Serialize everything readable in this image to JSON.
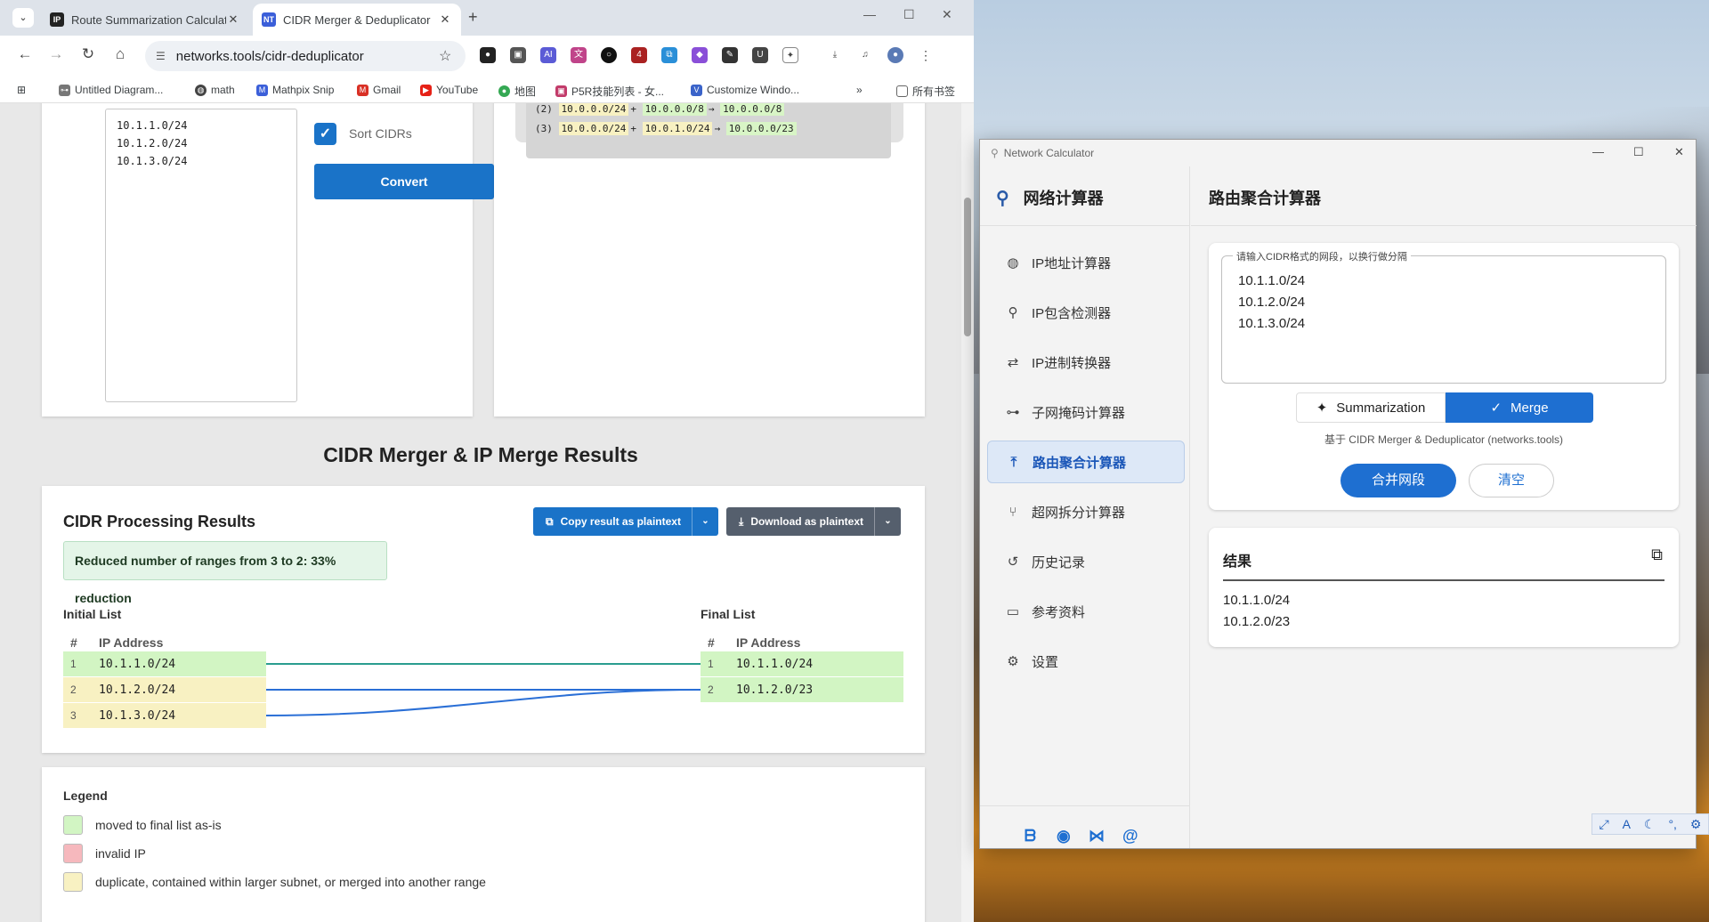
{
  "browser": {
    "tabs": [
      {
        "title": "Route Summarization Calculator",
        "favicon": "IP",
        "favicon_color": "#222222"
      },
      {
        "title": "CIDR Merger & Deduplicator",
        "favicon": "NT",
        "favicon_color": "#3b5fd9"
      }
    ],
    "url": "networks.tools/cidr-deduplicator",
    "bookmarks": [
      {
        "label": "Untitled Diagram...",
        "icon": "diagram-icon"
      },
      {
        "label": "math",
        "icon": "globe-icon"
      },
      {
        "label": "Mathpix Snip",
        "icon": "mathpix-icon"
      },
      {
        "label": "Gmail",
        "icon": "gmail-icon"
      },
      {
        "label": "YouTube",
        "icon": "youtube-icon"
      },
      {
        "label": "地图",
        "icon": "maps-icon"
      },
      {
        "label": "P5R技能列表 - 女...",
        "icon": "bookmark-icon"
      },
      {
        "label": "Customize Windo...",
        "icon": "customize-icon"
      },
      {
        "label": "所有书签",
        "icon": "folder-icon"
      }
    ]
  },
  "page": {
    "input_lines": "10.1.1.0/24\n10.1.2.0/24\n10.1.3.0/24",
    "sort_label": "Sort CIDRs",
    "convert_label": "Convert",
    "examples": [
      {
        "n": "(2)",
        "a": "10.0.0.0/24",
        "b": "10.0.0.0/8",
        "r": "10.0.0.0/8"
      },
      {
        "n": "(3)",
        "a": "10.0.0.0/24",
        "b": "10.0.1.0/24",
        "r": "10.0.0.0/23"
      }
    ],
    "heading": "CIDR Merger & IP Merge Results",
    "results_title": "CIDR Processing Results",
    "copy_label": "Copy result as plaintext",
    "download_label": "Download as plaintext",
    "reduction": "Reduced number of ranges from 3 to 2: 33% reduction",
    "initial_title": "Initial List",
    "final_title": "Final List",
    "col_num": "#",
    "col_ip": "IP Address",
    "initial": [
      {
        "n": "1",
        "ip": "10.1.1.0/24",
        "status": "moved"
      },
      {
        "n": "2",
        "ip": "10.1.2.0/24",
        "status": "merged"
      },
      {
        "n": "3",
        "ip": "10.1.3.0/24",
        "status": "merged"
      }
    ],
    "final": [
      {
        "n": "1",
        "ip": "10.1.1.0/24"
      },
      {
        "n": "2",
        "ip": "10.1.2.0/23"
      }
    ],
    "legend_title": "Legend",
    "legend": [
      {
        "label": "moved to final list as-is",
        "color": "#d2f5c3"
      },
      {
        "label": "invalid IP",
        "color": "#f6b8bd"
      },
      {
        "label": "duplicate, contained within larger subnet, or merged into another range",
        "color": "#f8f1c2"
      }
    ]
  },
  "app": {
    "window_title": "Network Calculator",
    "brand": "网络计算器",
    "nav": [
      {
        "label": "IP地址计算器",
        "icon": "globe-icon"
      },
      {
        "label": "IP包含检测器",
        "icon": "search-icon"
      },
      {
        "label": "IP进制转换器",
        "icon": "swap-icon"
      },
      {
        "label": "子网掩码计算器",
        "icon": "tree-icon"
      },
      {
        "label": "路由聚合计算器",
        "icon": "merge-icon",
        "active": true
      },
      {
        "label": "超网拆分计算器",
        "icon": "split-icon"
      },
      {
        "label": "历史记录",
        "icon": "history-icon"
      },
      {
        "label": "参考资料",
        "icon": "book-icon"
      },
      {
        "label": "设置",
        "icon": "gear-icon"
      }
    ],
    "page_title": "路由聚合计算器",
    "input_legend": "请输入CIDR格式的网段，以换行做分隔",
    "input_text": "10.1.1.0/24\n10.1.2.0/24\n10.1.3.0/24",
    "mode_summarization": "Summarization",
    "mode_merge": "Merge",
    "credit": "基于 CIDR Merger & Deduplicator (networks.tools)",
    "merge_btn": "合并网段",
    "clear_btn": "清空",
    "results_title": "结果",
    "results_text": "10.1.1.0/24\n10.1.2.0/23"
  }
}
